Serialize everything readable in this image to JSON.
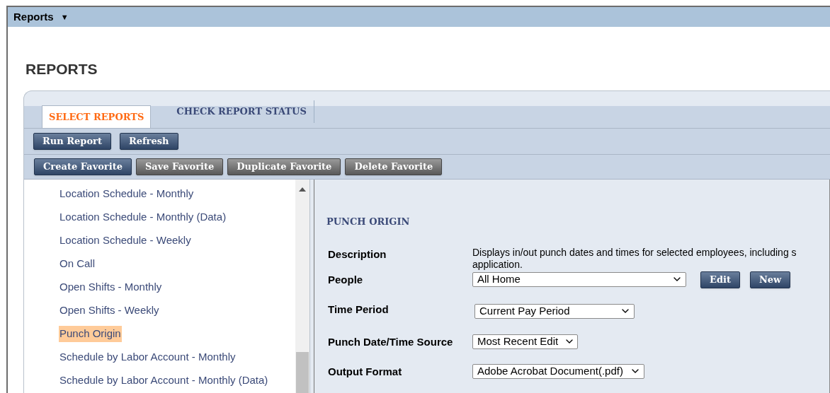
{
  "menu": {
    "label": "Reports",
    "caret": "▼"
  },
  "page_title": "REPORTS",
  "tabs": [
    {
      "label": "SELECT REPORTS",
      "selected": true
    },
    {
      "label": "CHECK REPORT STATUS",
      "selected": false
    }
  ],
  "toolbar": [
    {
      "label": "Run Report",
      "kind": "primary"
    },
    {
      "label": "Refresh",
      "kind": "primary"
    }
  ],
  "favorites_toolbar": [
    {
      "label": "Create Favorite",
      "kind": "primary"
    },
    {
      "label": "Save Favorite",
      "kind": "secondary"
    },
    {
      "label": "Duplicate Favorite",
      "kind": "secondary"
    },
    {
      "label": "Delete Favorite",
      "kind": "secondary"
    }
  ],
  "report_list": [
    {
      "label": "Location Schedule - Monthly",
      "selected": false
    },
    {
      "label": "Location Schedule - Monthly (Data)",
      "selected": false
    },
    {
      "label": "Location Schedule - Weekly",
      "selected": false
    },
    {
      "label": "On Call",
      "selected": false
    },
    {
      "label": "Open Shifts - Monthly",
      "selected": false
    },
    {
      "label": "Open Shifts - Weekly",
      "selected": false
    },
    {
      "label": "Punch Origin",
      "selected": true
    },
    {
      "label": "Schedule by Labor Account - Monthly",
      "selected": false
    },
    {
      "label": "Schedule by Labor Account - Monthly (Data)",
      "selected": false
    }
  ],
  "report": {
    "title": "PUNCH ORIGIN",
    "fields": [
      {
        "label": "Description",
        "kind": "text",
        "value": "Displays in/out punch dates and times for selected employees, including s\napplication."
      },
      {
        "label": "People",
        "kind": "select",
        "value": "All Home",
        "buttons": [
          "Edit",
          "New"
        ]
      },
      {
        "label": "Time Period",
        "kind": "select",
        "value": "Current Pay Period"
      },
      {
        "label": "Punch Date/Time Source",
        "kind": "select",
        "value": "Most Recent Edit"
      },
      {
        "label": "Output Format",
        "kind": "select",
        "value": "Adobe Acrobat Document(.pdf)"
      }
    ]
  }
}
